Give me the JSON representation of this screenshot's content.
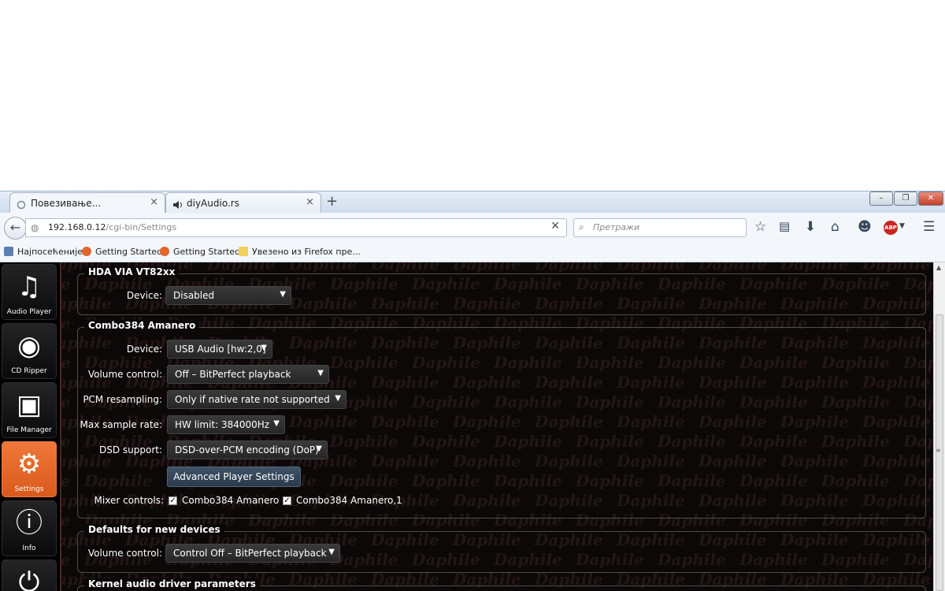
{
  "browser": {
    "tabs": [
      {
        "title": "Повезивање...",
        "icon": "loading-icon",
        "close": "×"
      },
      {
        "title": "diyAudio.rs",
        "icon": "speaker-icon",
        "close": "×"
      }
    ],
    "new_tab": "+",
    "window_buttons": {
      "minimize": "–",
      "restore": "❐",
      "close": "✕"
    },
    "url_host": "192.168.0.12",
    "url_path": "/cgi-bin/Settings",
    "url_clear": "✕",
    "search_placeholder": "Претражи",
    "toolbar_icons": [
      "star-icon",
      "reading-list-icon",
      "download-icon",
      "home-icon",
      "chat-icon",
      "adblock-icon",
      "menu-icon"
    ],
    "adblock_label": "ABP",
    "bookmarks": [
      {
        "label": "Најпосећеније",
        "icon": "bookmark-icon",
        "color": "#5b7fb0"
      },
      {
        "label": "Getting Started",
        "icon": "firefox-icon",
        "color": "#e0662b"
      },
      {
        "label": "Getting Started",
        "icon": "firefox-icon",
        "color": "#e0662b"
      },
      {
        "label": "Увезено из Firefox пре...",
        "icon": "folder-icon",
        "color": "#f1cf5a"
      }
    ]
  },
  "sidebar": {
    "items": [
      {
        "label": "Audio Player",
        "icon": "music-note-icon",
        "glyph": "♫",
        "active": false
      },
      {
        "label": "CD Ripper",
        "icon": "disc-icon",
        "glyph": "◉",
        "active": false
      },
      {
        "label": "File Manager",
        "icon": "box-icon",
        "glyph": "▣",
        "active": false
      },
      {
        "label": "Settings",
        "icon": "gears-icon",
        "glyph": "⚙",
        "active": true
      },
      {
        "label": "Info",
        "icon": "info-icon",
        "glyph": "ⓘ",
        "active": false
      },
      {
        "label": "",
        "icon": "power-icon",
        "glyph": "⏻",
        "active": false
      }
    ]
  },
  "watermark_text": "Daphile",
  "groups": {
    "hda": {
      "legend": "HDA VIA VT82xx",
      "device_label": "Device:",
      "device_value": "Disabled"
    },
    "combo": {
      "legend": "Combo384 Amanero",
      "device_label": "Device:",
      "device_value": "USB Audio [hw:2,0]",
      "volume_label": "Volume control:",
      "volume_value": "Off – BitPerfect playback",
      "pcm_label": "PCM resampling:",
      "pcm_value": "Only if native rate not supported",
      "maxrate_label": "Max sample rate:",
      "maxrate_value": "HW limit: 384000Hz",
      "dsd_label": "DSD support:",
      "dsd_value": "DSD-over-PCM encoding (DoP)",
      "advanced_button": "Advanced Player Settings",
      "mixer_label": "Mixer controls:",
      "mixer_options": [
        {
          "label": "Combo384 Amanero",
          "checked": true
        },
        {
          "label": "Combo384 Amanero,1",
          "checked": true
        }
      ]
    },
    "defaults": {
      "legend": "Defaults for new devices",
      "volume_label": "Volume control:",
      "volume_value": "Control Off – BitPerfect playback"
    },
    "kernel": {
      "legend": "Kernel audio driver parameters"
    }
  },
  "colors": {
    "accent": "#e8692a",
    "page_bg": "#0c0808",
    "watermark": "#231616",
    "button": "#34475a"
  }
}
